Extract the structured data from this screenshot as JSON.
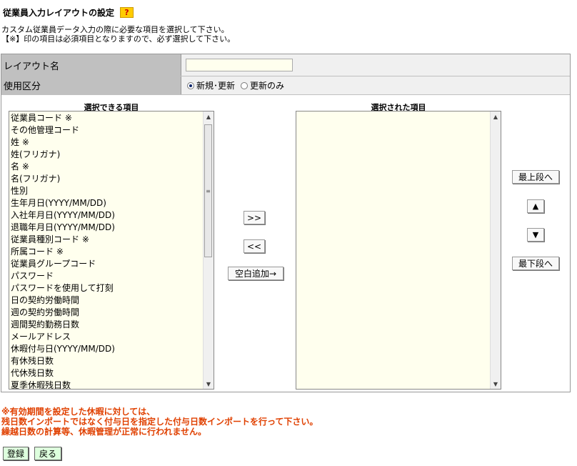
{
  "page": {
    "title": "従業員入力レイアウトの設定",
    "help_label": "?",
    "description": [
      "カスタム従業員データ入力の際に必要な項目を選択して下さい。",
      "【※】印の項目は必須項目となりますので、必ず選択して下さい。"
    ]
  },
  "form": {
    "layout_name_label": "レイアウト名",
    "layout_name_value": "",
    "usage_label": "使用区分",
    "usage_options": [
      {
        "label": "新規･更新",
        "selected": true
      },
      {
        "label": "更新のみ",
        "selected": false
      }
    ]
  },
  "available": {
    "header": "選択できる項目",
    "items": [
      "従業員コード ※",
      "その他管理コード",
      "姓 ※",
      "姓(フリガナ)",
      "名 ※",
      "名(フリガナ)",
      "性別",
      "生年月日(YYYY/MM/DD)",
      "入社年月日(YYYY/MM/DD)",
      "退職年月日(YYYY/MM/DD)",
      "従業員種別コード ※",
      "所属コード ※",
      "従業員グループコード",
      "パスワード",
      "パスワードを使用して打刻",
      "日の契約労働時間",
      "週の契約労働時間",
      "週間契約勤務日数",
      "メールアドレス",
      "休暇付与日(YYYY/MM/DD)",
      "有休残日数",
      "代休残日数",
      "夏季休暇残日数"
    ]
  },
  "selected": {
    "header": "選択された項目",
    "items": []
  },
  "buttons": {
    "add": ">>",
    "remove": "<<",
    "add_blank": "空白追加→",
    "to_top": "最上段へ",
    "up": "▲",
    "down": "▼",
    "to_bottom": "最下段へ",
    "register": "登録",
    "back": "戻る"
  },
  "warning": [
    "※有効期間を設定した休暇に対しては、",
    "残日数インポートではなく付与日を指定した付与日数インポートを行って下さい。",
    "繰越日数の計算等、休暇管理が正常に行われません。"
  ],
  "colors": {
    "list_bg": "#ffffee",
    "label_bg": "#c0c0c0",
    "warning": "#e04000",
    "footer_button_bg": "#ddffdd",
    "help_bg": "#ffcc00"
  }
}
